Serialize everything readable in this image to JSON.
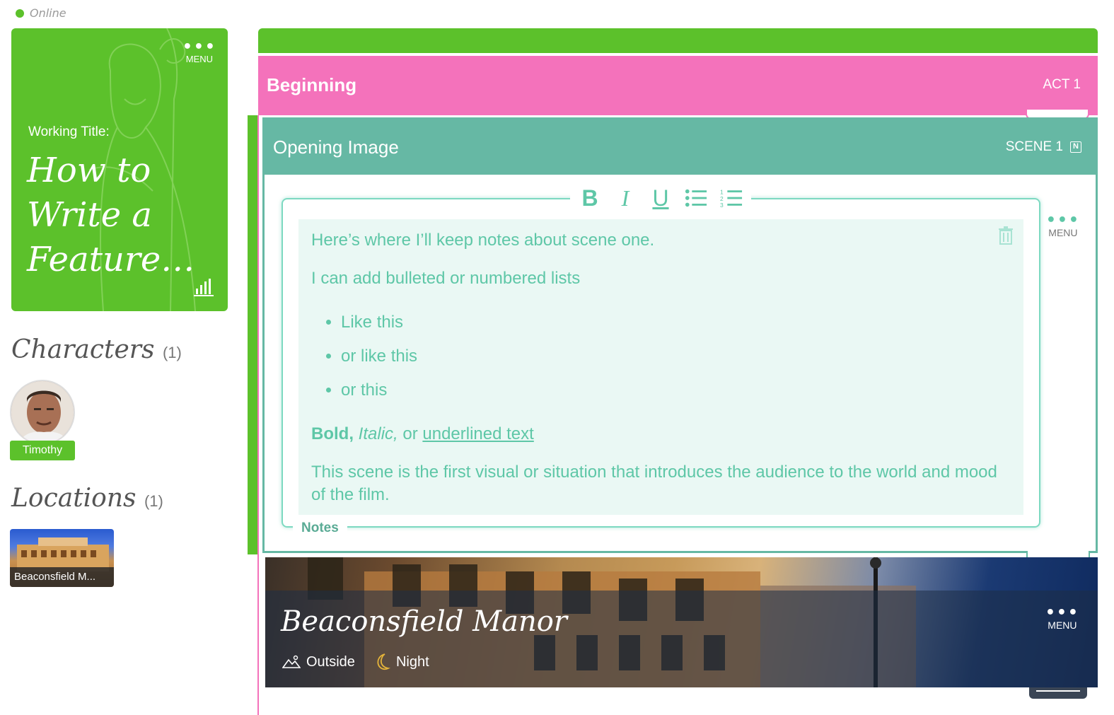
{
  "status": {
    "text": "Online",
    "color": "#5cc12b"
  },
  "title_card": {
    "menu_label": "MENU",
    "working_label": "Working Title:",
    "title": "How to Write a Feature…",
    "bg_color": "#5cc12b"
  },
  "characters": {
    "heading": "Characters",
    "count": "(1)",
    "items": [
      {
        "name": "Timothy"
      }
    ]
  },
  "locations": {
    "heading": "Locations",
    "count": "(1)",
    "items": [
      {
        "name": "Beaconsfield M..."
      }
    ]
  },
  "act": {
    "title": "Beginning",
    "label": "ACT 1",
    "color": "#f472bb"
  },
  "scene": {
    "title": "Opening Image",
    "label": "SCENE 1",
    "badge": "N",
    "menu_label": "MENU",
    "color": "#66b8a4"
  },
  "toolbar": {
    "bold": "B",
    "italic": "I",
    "underline": "U"
  },
  "notes": {
    "label": "Notes",
    "line1": "Here’s where I’ll keep notes about scene one.",
    "line2": "I can add bulleted or numbered lists",
    "bullets": [
      "Like this",
      "or like this",
      "or this"
    ],
    "bold_text": "Bold,",
    "italic_text": "Italic,",
    "or_text": "or",
    "underline_text": "underlined text",
    "line4": "This scene is the first visual or situation that introduces the audience to the world and mood of the film."
  },
  "location_scene": {
    "title": "Beaconsfield Manor",
    "setting": "Outside",
    "time": "Night",
    "menu_label": "MENU"
  }
}
